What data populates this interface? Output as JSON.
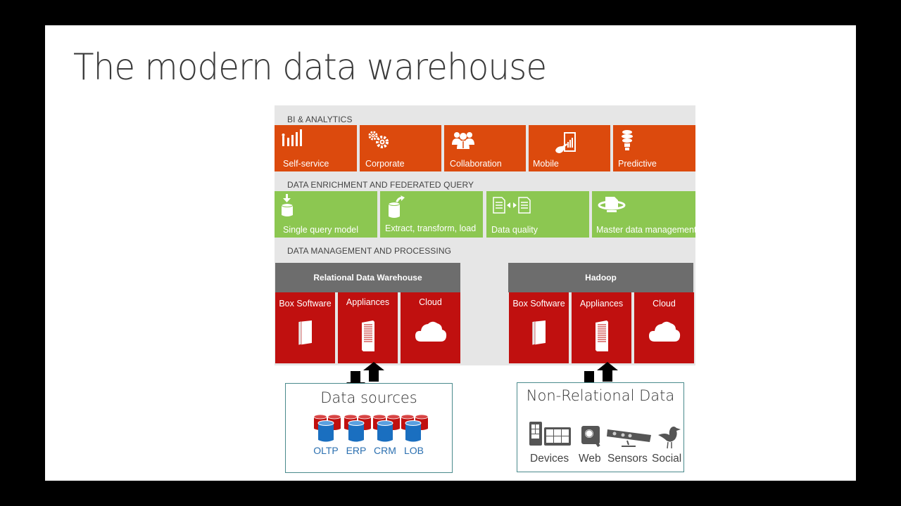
{
  "slide": {
    "title": "The modern data warehouse"
  },
  "bi_analytics": {
    "heading": "BI & ANALYTICS",
    "color": "#dc4a0d",
    "tiles": [
      {
        "label": "Self-service",
        "icon": "bar-chart-icon"
      },
      {
        "label": "Corporate",
        "icon": "gears-icon"
      },
      {
        "label": "Collaboration",
        "icon": "people-icon"
      },
      {
        "label": "Mobile",
        "icon": "mobile-touch-icon"
      },
      {
        "label": "Predictive",
        "icon": "lightbulb-icon"
      }
    ]
  },
  "data_enrichment": {
    "heading": "DATA ENRICHMENT AND FEDERATED QUERY",
    "color": "#8cc751",
    "tiles": [
      {
        "label": "Single query model",
        "icon": "database-arrow-in-icon"
      },
      {
        "label": "Extract, transform, load",
        "icon": "database-arrow-out-icon"
      },
      {
        "label": "Data quality",
        "icon": "document-compare-icon"
      },
      {
        "label": "Master data management",
        "icon": "document-ring-icon"
      }
    ]
  },
  "data_management": {
    "heading": "DATA MANAGEMENT AND PROCESSING",
    "groups": [
      {
        "title": "Relational Data Warehouse",
        "items": [
          {
            "label": "Box Software",
            "icon": "box-icon"
          },
          {
            "label": "Appliances",
            "icon": "server-icon"
          },
          {
            "label": "Cloud",
            "icon": "cloud-icon"
          }
        ]
      },
      {
        "title": "Hadoop",
        "items": [
          {
            "label": "Box Software",
            "icon": "box-icon"
          },
          {
            "label": "Appliances",
            "icon": "server-icon"
          },
          {
            "label": "Cloud",
            "icon": "cloud-icon"
          }
        ]
      }
    ],
    "header_color": "#6d6d6d",
    "tile_color": "#c0100f"
  },
  "data_sources": {
    "title": "Data sources",
    "items": [
      "OLTP",
      "ERP",
      "CRM",
      "LOB"
    ]
  },
  "non_relational": {
    "title": "Non-Relational Data",
    "items": [
      {
        "label": "Devices",
        "icon": "devices-icon"
      },
      {
        "label": "Web",
        "icon": "web-search-icon"
      },
      {
        "label": "Sensors",
        "icon": "sensor-bar-icon"
      },
      {
        "label": "Social",
        "icon": "bird-icon"
      }
    ]
  }
}
